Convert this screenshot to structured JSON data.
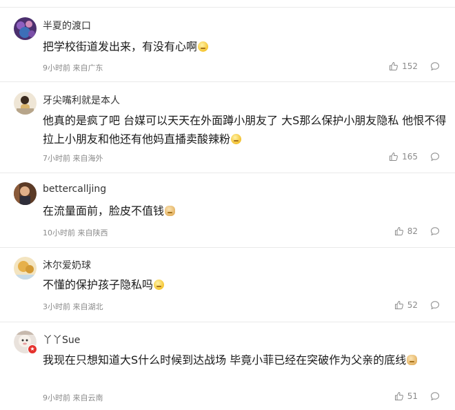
{
  "comments": [
    {
      "username": "半夏的渡口",
      "text": "把学校街道发出来，有没有心啊",
      "emoji": "sleepy-face-emoji",
      "meta": "9小时前 来自广东",
      "likes": "152",
      "avatar_color": "#5a3b7a"
    },
    {
      "username": "牙尖嘴利就是本人",
      "text": "他真的是疯了吧 台媒可以天天在外面蹲小朋友了 大S那么保护小朋友隐私 他恨不得拉上小朋友和他还有他妈直播卖酸辣粉",
      "emoji": "smile-face-emoji",
      "meta": "7小时前 来自海外",
      "likes": "165",
      "avatar_color": "#c9a36a"
    },
    {
      "username": "bettercalljing",
      "text": "在流量面前，脸皮不值钱",
      "emoji": "doge-emoji",
      "meta": "10小时前 来自陕西",
      "likes": "82",
      "avatar_color": "#7a4a2e"
    },
    {
      "username": "沐尔爱奶球",
      "text": "不懂的保护孩子隐私吗",
      "emoji": "sleepy-face-emoji",
      "meta": "3小时前 来自湖北",
      "likes": "52",
      "avatar_color": "#e0b252"
    },
    {
      "username": "丫丫Sue",
      "text": "我现在只想知道大S什么时候到达战场 毕竟小菲已经在突破作为父亲的底线",
      "emoji": "doge-emoji",
      "meta": "9小时前 来自云南",
      "likes": "51",
      "avatar_color": "#d8d0c8"
    }
  ],
  "colors": {
    "divider": "#e9e9e9",
    "meta_text": "#8a8a8a",
    "badge": "#e5322d"
  }
}
